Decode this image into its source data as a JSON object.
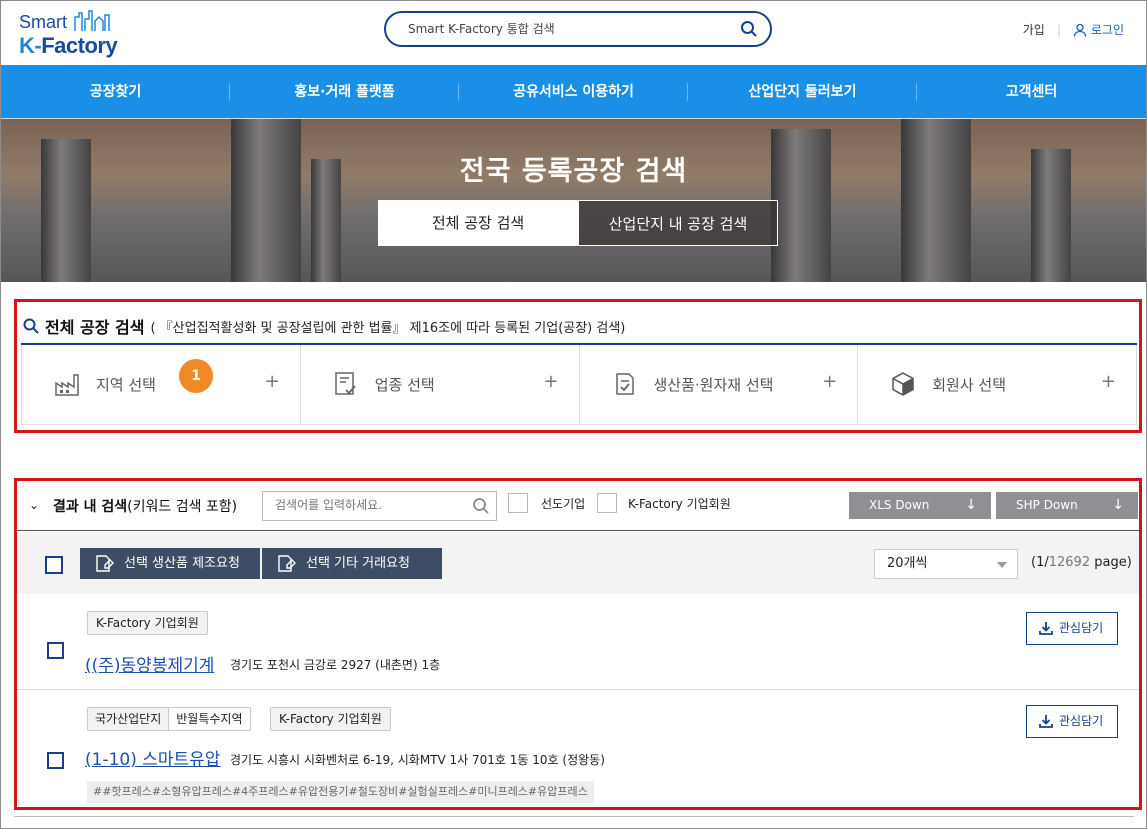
{
  "header": {
    "logo_line1": "Smart",
    "logo_line2_k": "K-",
    "logo_line2_rest": "Factory",
    "search_placeholder": "Smart K-Factory 통합 검색",
    "join": "가입",
    "login": "로그인"
  },
  "nav": [
    "공장찾기",
    "홍보·거래 플랫폼",
    "공유서비스 이용하기",
    "산업단지 둘러보기",
    "고객센터"
  ],
  "banner": {
    "title": "전국 등록공장 검색",
    "tab_active": "전체 공장 검색",
    "tab_inactive": "산업단지 내 공장 검색"
  },
  "search_panel": {
    "title": "전체 공장 검색",
    "subtitle": "( 『산업집적활성화 및 공장설립에 관한 법률』 제16조에 따라 등록된 기업(공장) 검색)",
    "categories": [
      {
        "label": "지역 선택",
        "icon": "factory-icon"
      },
      {
        "label": "업종 선택",
        "icon": "checklist-icon"
      },
      {
        "label": "생산품·원자재 선택",
        "icon": "document-check-icon"
      },
      {
        "label": "회원사 선택",
        "icon": "cube-icon"
      }
    ],
    "plus": "+",
    "step_badge": "1"
  },
  "results": {
    "title_bold": "결과 내 검색",
    "title_rest": "(키워드 검색 포함)",
    "keyword_placeholder": "검색어를 입력하세요.",
    "filter1": "선도기업",
    "filter2": "K-Factory 기업회원",
    "xls_down": "XLS Down",
    "shp_down": "SHP Down",
    "action1": "선택 생산품 제조요청",
    "action2": "선택 기타 거래요청",
    "per_page": "20개씩",
    "page_prefix": "(1/",
    "page_total": "12692",
    "page_suffix": " page)",
    "fav_label": "관심담기",
    "items": [
      {
        "tag": "K-Factory 기업회원",
        "name": "((주)동양봉제기계",
        "address": "경기도 포천시 금강로 2927 (내촌면) 1층"
      },
      {
        "tag_a_left": "국가산업단지",
        "tag_a_right": "반월특수지역",
        "tag_b": "K-Factory 기업회원",
        "name": "(1-10) 스마트유압",
        "address": "경기도 시흥시 시화벤처로 6-19, 시화MTV 1사 701호 1동 10호 (정왕동)",
        "keywords": "##핫프레스#소형유압프레스#4주프레스#유압전용기#철도장비#실험실프레스#미니프레스#유압프레스"
      }
    ]
  },
  "colors": {
    "nav_bg": "#1a8fe8",
    "brand_navy": "#1a3f8c",
    "highlight_red": "#d8111a",
    "badge_orange": "#f08a24",
    "action_button": "#3e4d66"
  }
}
